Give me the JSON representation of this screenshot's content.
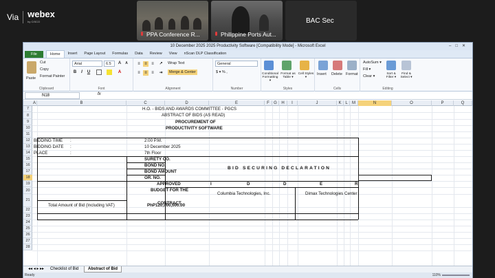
{
  "webex": {
    "via": "Via",
    "brand": "webex",
    "by": "by CISCO",
    "tiles": [
      {
        "label": "PPA Conference R..."
      },
      {
        "label": "Philippine Ports Aut..."
      },
      {
        "label": "BAC Sec"
      }
    ]
  },
  "excel": {
    "title": "10 December 2025 2025 Productivity Software  [Compatibility Mode] - Microsoft Excel",
    "tabs": [
      "File",
      "Home",
      "Insert",
      "Page Layout",
      "Formulas",
      "Data",
      "Review",
      "View",
      "nScan DLP Classification"
    ],
    "ribbon": {
      "paste": "Paste",
      "cut": "Cut",
      "copy": "Copy",
      "format_painter": "Format Painter",
      "clipboard": "Clipboard",
      "font_name": "Arial",
      "font_size": "6.5",
      "font": "Font",
      "wrap_text": "Wrap Text",
      "merge_center": "Merge & Center",
      "alignment": "Alignment",
      "number_format": "General",
      "number": "Number",
      "number_symbols": "$ ▾ %  ,",
      "cond_format": "Conditional Formatting ▾",
      "format_table": "Format as Table ▾",
      "cell_styles": "Cell Styles ▾",
      "styles": "Styles",
      "insert": "Insert",
      "delete": "Delete",
      "format": "Format",
      "cells": "Cells",
      "autosum": "AutoSum ▾",
      "fill": "Fill ▾",
      "clear": "Clear ▾",
      "sort_filter": "Sort & Filter ▾",
      "find_select": "Find & Select ▾",
      "editing": "Editing"
    },
    "name_box": "N18",
    "fx": "fx",
    "columns": [
      "A",
      "B",
      "C",
      "D",
      "E",
      "F",
      "G",
      "H",
      "I",
      "J",
      "K",
      "L",
      "M",
      "N",
      "O",
      "P",
      "Q"
    ],
    "rows": [
      "7",
      "8",
      "9",
      "10",
      "11",
      "12",
      "13",
      "14",
      "15",
      "16",
      "17",
      "18",
      "19",
      "20",
      "21",
      "22",
      "23",
      "24",
      "25",
      "26",
      "27",
      "28"
    ],
    "cells": {
      "r7": "H.O. - BIDS AND AWARDS COMMITTEE - PGCS",
      "r8": "ABSTRACT OF BIDS (AS READ)",
      "r9": "PROCUREMENT OF",
      "r10": "PRODUCTIVITY SOFTWARE",
      "bidding_time": "BIDDING TIME",
      "bidding_date": "BIDDING DATE",
      "place": "PLACE",
      "colon": ":",
      "time_val": "2:00 P.M.",
      "date_val": "10 December 2025",
      "place_val": "7th Floor",
      "surety": "SURETY CO.",
      "bond_no": "BOND NO.",
      "bond_amount": "BOND AMOUNT",
      "or_no": "OR. NO.",
      "approved": "APPROVED",
      "budget_for_the": "BUDGET FOR THE",
      "contract": "CONTRACT",
      "bid_securing": "BID SECURING DECLARATION",
      "h_i": "I",
      "h_d1": "D",
      "h_d2": "D",
      "h_e": "E",
      "h_r": "R",
      "bidder1": "Columbia Technologies, Inc.",
      "bidder2": "Dimax Technologies Center",
      "total_label": "Total Amount of Bid (Including VAT)",
      "total_value": "PhP120,000,000.00"
    },
    "sheets": [
      "Checklist of Bid",
      "Abstract of Bid"
    ],
    "status": "Ready",
    "zoom": "110%"
  }
}
